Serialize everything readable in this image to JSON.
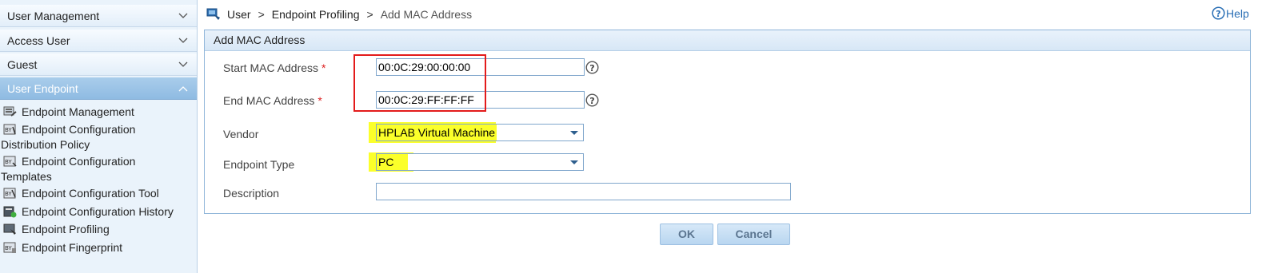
{
  "sidebar": {
    "menus": [
      {
        "label": "User Management",
        "expanded": false
      },
      {
        "label": "Access User",
        "expanded": false
      },
      {
        "label": "Guest",
        "expanded": false
      },
      {
        "label": "User Endpoint",
        "expanded": true
      }
    ],
    "items": [
      {
        "label": "Endpoint Management",
        "icon": "endpoint-management-icon"
      },
      {
        "label": "Endpoint Configuration",
        "cont": "Distribution Policy",
        "icon": "config-distribution-icon"
      },
      {
        "label": "Endpoint Configuration",
        "cont": "Templates",
        "icon": "config-templates-icon"
      },
      {
        "label": "Endpoint Configuration Tool",
        "icon": "config-tool-icon"
      },
      {
        "label": "Endpoint Configuration History",
        "icon": "config-history-icon"
      },
      {
        "label": "Endpoint Profiling",
        "icon": "endpoint-profiling-icon"
      },
      {
        "label": "Endpoint Fingerprint",
        "icon": "endpoint-fingerprint-icon"
      }
    ]
  },
  "breadcrumb": {
    "items": [
      "User",
      "Endpoint Profiling",
      "Add MAC Address"
    ],
    "separator": ">"
  },
  "help": {
    "label": "Help",
    "icon": "help-circle-icon"
  },
  "panel": {
    "title": "Add MAC Address"
  },
  "form": {
    "start_mac": {
      "label": "Start MAC Address",
      "required_mark": "*",
      "value": "00:0C:29:00:00:00"
    },
    "end_mac": {
      "label": "End MAC Address",
      "required_mark": "*",
      "value": "00:0C:29:FF:FF:FF"
    },
    "vendor": {
      "label": "Vendor",
      "value": "HPLAB Virtual Machine"
    },
    "endpoint_type": {
      "label": "Endpoint Type",
      "value": "PC"
    },
    "description": {
      "label": "Description",
      "value": ""
    }
  },
  "buttons": {
    "ok": "OK",
    "cancel": "Cancel"
  },
  "colors": {
    "highlight": "#fbff2a",
    "annotation_box": "#e31b1b",
    "accent": "#2a6fb5"
  }
}
